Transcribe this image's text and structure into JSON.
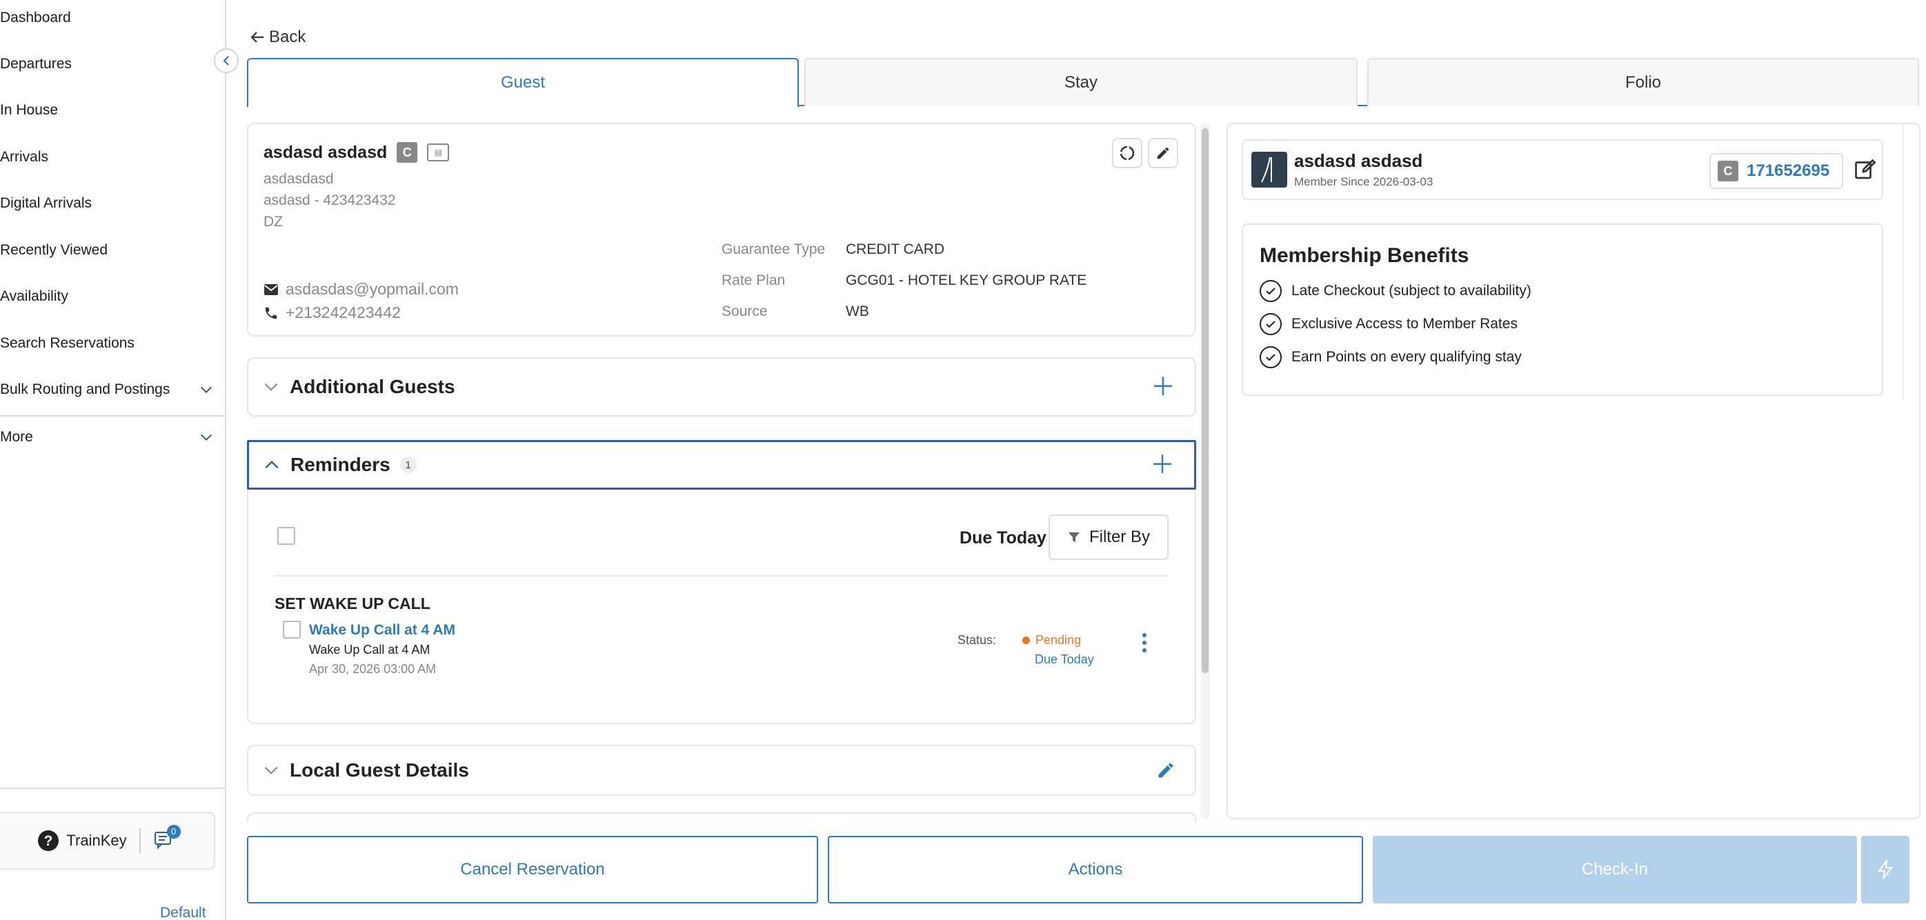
{
  "sidebar": {
    "items": [
      {
        "label": "Dashboard"
      },
      {
        "label": "Departures"
      },
      {
        "label": "In House"
      },
      {
        "label": "Arrivals"
      },
      {
        "label": "Digital Arrivals"
      },
      {
        "label": "Recently Viewed"
      },
      {
        "label": "Availability"
      },
      {
        "label": "Search Reservations"
      },
      {
        "label": "Bulk Routing and Postings"
      },
      {
        "label": "More"
      }
    ],
    "trainkey_label": "TrainKey",
    "messages_count": "0",
    "default_label": "Default"
  },
  "header": {
    "back_label": "Back"
  },
  "tabs": [
    {
      "label": "Guest"
    },
    {
      "label": "Stay"
    },
    {
      "label": "Folio"
    }
  ],
  "guest": {
    "name": "asdasd asdasd",
    "line1": "asdasdasd",
    "line2": "asdasd  - 423423432",
    "line3": "DZ",
    "email": "asdasdas@yopmail.com",
    "phone": "+213242423442",
    "guarantee_label": "Guarantee Type",
    "guarantee_value": "CREDIT CARD",
    "rate_label": "Rate Plan",
    "rate_value": "GCG01 - HOTEL KEY GROUP RATE",
    "source_label": "Source",
    "source_value": "WB"
  },
  "sections": {
    "additional_guests": "Additional Guests",
    "reminders": "Reminders",
    "reminders_count": "1",
    "local_guest_details": "Local Guest Details"
  },
  "reminders": {
    "due_today_label": "Due Today",
    "filter_label": "Filter By",
    "group_title": "SET WAKE UP CALL",
    "item_title": "Wake Up Call at 4 AM",
    "item_desc": "Wake Up Call at 4 AM",
    "item_date": "Apr 30, 2026 03:00 AM",
    "status_label": "Status:",
    "status_value": "Pending",
    "due_value": "Due Today"
  },
  "membership": {
    "name": "asdasd asdasd",
    "since": "Member Since 2026-03-03",
    "number": "171652695",
    "benefits_title": "Membership Benefits",
    "benefits": [
      "Late Checkout (subject to availability)",
      "Exclusive Access to Member Rates",
      "Earn Points on every qualifying stay"
    ]
  },
  "footer": {
    "cancel_label": "Cancel Reservation",
    "actions_label": "Actions",
    "checkin_label": "Check-In"
  },
  "colors": {
    "accent": "#2f7ab8",
    "pending": "#e07a26",
    "disabled": "#b3d1ea"
  }
}
